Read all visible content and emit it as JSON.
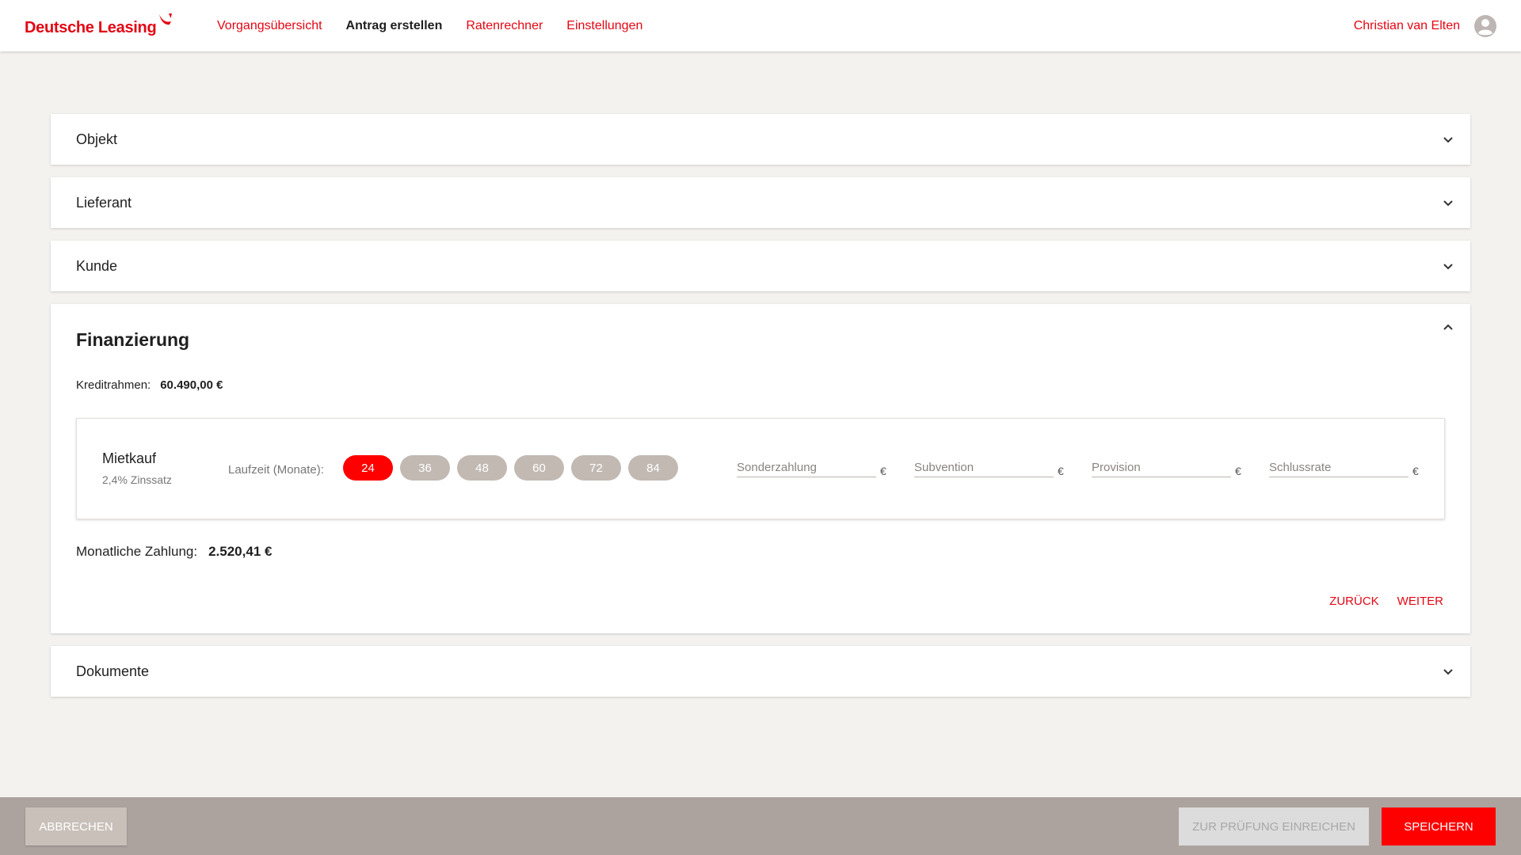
{
  "brand": {
    "name": "Deutsche Leasing",
    "color": "#e30613",
    "icon": "sparkasse-swoosh-icon"
  },
  "nav": {
    "items": [
      {
        "label": "Vorgangsübersicht",
        "active": false
      },
      {
        "label": "Antrag erstellen",
        "active": true
      },
      {
        "label": "Ratenrechner",
        "active": false
      },
      {
        "label": "Einstellungen",
        "active": false
      }
    ]
  },
  "user": {
    "name": "Christian van Elten",
    "icon": "user-avatar-icon"
  },
  "sections": {
    "objekt": {
      "title": "Objekt",
      "icon": "chevron-down-icon"
    },
    "lieferant": {
      "title": "Lieferant",
      "icon": "chevron-down-icon"
    },
    "kunde": {
      "title": "Kunde",
      "icon": "chevron-down-icon"
    },
    "dokumente": {
      "title": "Dokumente",
      "icon": "chevron-down-icon"
    }
  },
  "finanzierung": {
    "title": "Finanzierung",
    "icon": "chevron-up-icon",
    "kreditrahmen_label": "Kreditrahmen:",
    "kreditrahmen_value": "60.490,00 €",
    "product": {
      "name": "Mietkauf",
      "rate": "2,4% Zinssatz"
    },
    "laufzeit_label": "Laufzeit (Monate):",
    "laufzeit_options": [
      "24",
      "36",
      "48",
      "60",
      "72",
      "84"
    ],
    "laufzeit_selected": "24",
    "fields": [
      {
        "placeholder": "Sonderzahlung",
        "value": "",
        "unit": "€"
      },
      {
        "placeholder": "Subvention",
        "value": "",
        "unit": "€"
      },
      {
        "placeholder": "Provision",
        "value": "",
        "unit": "€"
      },
      {
        "placeholder": "Schlussrate",
        "value": "",
        "unit": "€"
      }
    ],
    "monthly_label": "Monatliche Zahlung:",
    "monthly_value": "2.520,41 €",
    "back_label": "Zurück",
    "next_label": "Weiter"
  },
  "footer": {
    "cancel_label": "Abbrechen",
    "submit_label": "Zur Prüfung einreichen",
    "save_label": "Speichern"
  },
  "colors": {
    "accent": "#e30613",
    "chip_selected": "#ff0000",
    "chip_default": "#c2b9b3",
    "footer_bg": "#aca39f",
    "page_bg": "#f3f2ef"
  }
}
